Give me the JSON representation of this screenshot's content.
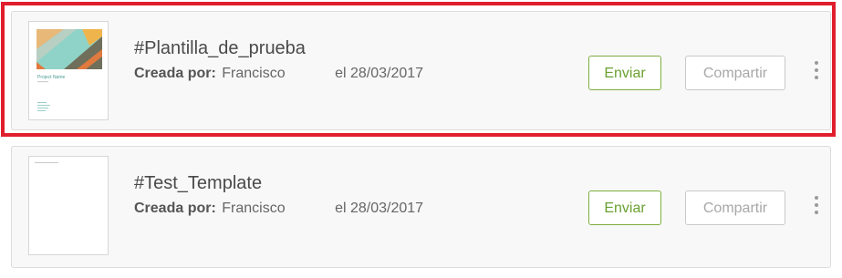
{
  "templates": [
    {
      "title": "#Plantilla_de_prueba",
      "created_label": "Creada por:",
      "author": "Francisco",
      "date_text": "el 28/03/2017",
      "send_label": "Enviar",
      "share_label": "Compartir",
      "thumbnail_text": "Project Name",
      "highlighted": true
    },
    {
      "title": "#Test_Template",
      "created_label": "Creada por:",
      "author": "Francisco",
      "date_text": "el 28/03/2017",
      "send_label": "Enviar",
      "share_label": "Compartir",
      "highlighted": false
    }
  ],
  "colors": {
    "highlight_border": "#e01f2d",
    "send_accent": "#6aa131",
    "share_muted": "#a8a8a8"
  },
  "icons": {
    "more": "more-vertical-icon"
  }
}
